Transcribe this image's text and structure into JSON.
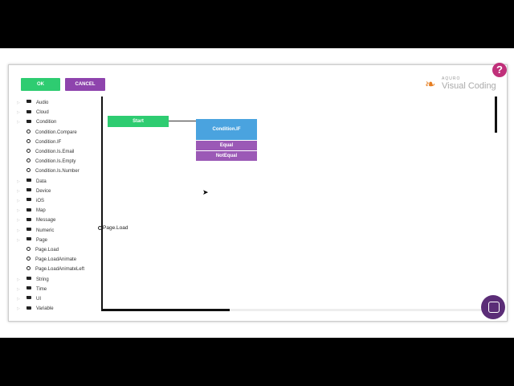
{
  "dialog": {
    "ok_label": "OK",
    "cancel_label": "CANCEL",
    "help_label": "?",
    "brand_company": "AQURO",
    "brand_product": "Visual Coding"
  },
  "tree": {
    "items": [
      {
        "label": "Audio",
        "type": "folder",
        "level": 0
      },
      {
        "label": "Cloud",
        "type": "folder",
        "level": 0
      },
      {
        "label": "Condition",
        "type": "folder",
        "level": 0
      },
      {
        "label": "Condition.Compare",
        "type": "leaf",
        "level": 1
      },
      {
        "label": "Condition.IF",
        "type": "leaf",
        "level": 1
      },
      {
        "label": "Condition.Is.Email",
        "type": "leaf",
        "level": 1
      },
      {
        "label": "Condition.Is.Empty",
        "type": "leaf",
        "level": 1
      },
      {
        "label": "Condition.Is.Number",
        "type": "leaf",
        "level": 1
      },
      {
        "label": "Data",
        "type": "folder",
        "level": 0
      },
      {
        "label": "Device",
        "type": "folder",
        "level": 0
      },
      {
        "label": "iOS",
        "type": "folder",
        "level": 0
      },
      {
        "label": "Map",
        "type": "folder",
        "level": 0
      },
      {
        "label": "Message",
        "type": "folder",
        "level": 0
      },
      {
        "label": "Numeric",
        "type": "folder",
        "level": 0
      },
      {
        "label": "Page",
        "type": "folder",
        "level": 0
      },
      {
        "label": "Page.Load",
        "type": "leaf",
        "level": 1
      },
      {
        "label": "Page.LoadAnimate",
        "type": "leaf",
        "level": 1
      },
      {
        "label": "Page.LoadAnimateLeft",
        "type": "leaf",
        "level": 1
      },
      {
        "label": "String",
        "type": "folder",
        "level": 0
      },
      {
        "label": "Time",
        "type": "folder",
        "level": 0
      },
      {
        "label": "UI",
        "type": "folder",
        "level": 0
      },
      {
        "label": "Variable",
        "type": "folder",
        "level": 0
      }
    ]
  },
  "canvas": {
    "start_label": "Start",
    "condition_title": "Condition.IF",
    "condition_options": [
      "Equal",
      "NotEqual"
    ],
    "node_label": "Page.Load"
  },
  "colors": {
    "ok": "#2ecc71",
    "cancel": "#8e44ad",
    "start": "#2ecc71",
    "condition_head": "#4aa3df",
    "condition_option": "#9b59b6",
    "help": "#c0307a",
    "chat": "#5b2d77"
  },
  "icons": {
    "folder": "folder-icon",
    "leaf": "gear-icon",
    "help": "help-icon",
    "chat": "chat-icon",
    "brand": "feather-icon"
  }
}
